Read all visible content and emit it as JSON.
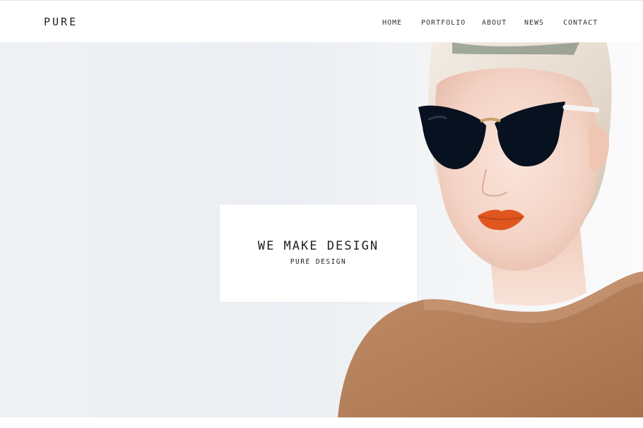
{
  "brand": {
    "logo_text": "PURE"
  },
  "nav": {
    "items": [
      {
        "label": "HOME"
      },
      {
        "label": "PORTFOLIO"
      },
      {
        "label": "ABOUT"
      },
      {
        "label": "NEWS"
      },
      {
        "label": "CONTACT"
      }
    ]
  },
  "hero": {
    "title": "WE MAKE DESIGN",
    "subtitle": "PURE DESIGN",
    "image_subject": "woman-with-sunglasses-photo"
  },
  "colors": {
    "text": "#1e1e1e",
    "background": "#ffffff",
    "hero_bg": "#eef1f4",
    "sweater": "#b7835f",
    "lips": "#e0561f",
    "sunglasses": "#0a1220"
  }
}
